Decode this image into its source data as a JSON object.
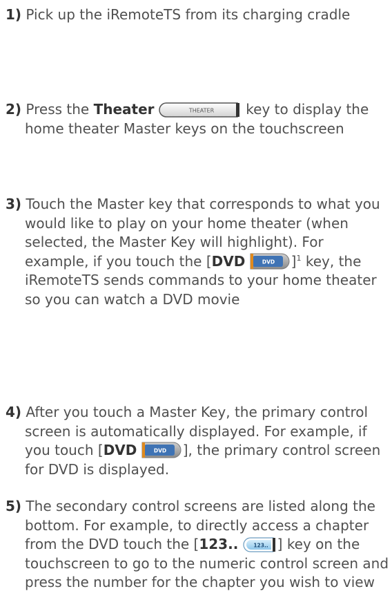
{
  "steps": [
    {
      "number": "1)",
      "text": "Pick up the iRemoteTS from its charging cradle"
    },
    {
      "number": "2)",
      "pre": "Press the ",
      "key_name": "Theater",
      "key_label": "THEATER",
      "post": " key to display the home theater Master keys on the touchscreen"
    },
    {
      "number": "3)",
      "pre": "Touch the Master key that corresponds to what you would like to play on your home theater (when selected, the Master Key will highlight). For example, if you touch the [",
      "key_name": "DVD",
      "key_label": "DVD",
      "mid": "]",
      "footnote": "1",
      "post": " key, the iRemoteTS sends commands to your home theater so you can watch a DVD movie"
    },
    {
      "number": "4)",
      "pre": "After you touch a Master Key, the primary control screen is automatically displayed. For example, if you touch [",
      "key_name": "DVD",
      "key_label": "DVD",
      "post": "], the primary control screen for DVD is displayed."
    },
    {
      "number": "5)",
      "pre": "The secondary control screens are listed along the bottom. For example, to directly access a chapter from the DVD touch the [",
      "key_name": "123..",
      "key_label": "123..",
      "post": "] key on the touchscreen to go to the numeric control screen and press the number for the chapter you wish to view"
    }
  ],
  "colors": {
    "text": "#505050",
    "theater_key": "#e6e6e6",
    "dvd_key": "#3f73b4",
    "numeric_key": "#a9d6f2"
  }
}
